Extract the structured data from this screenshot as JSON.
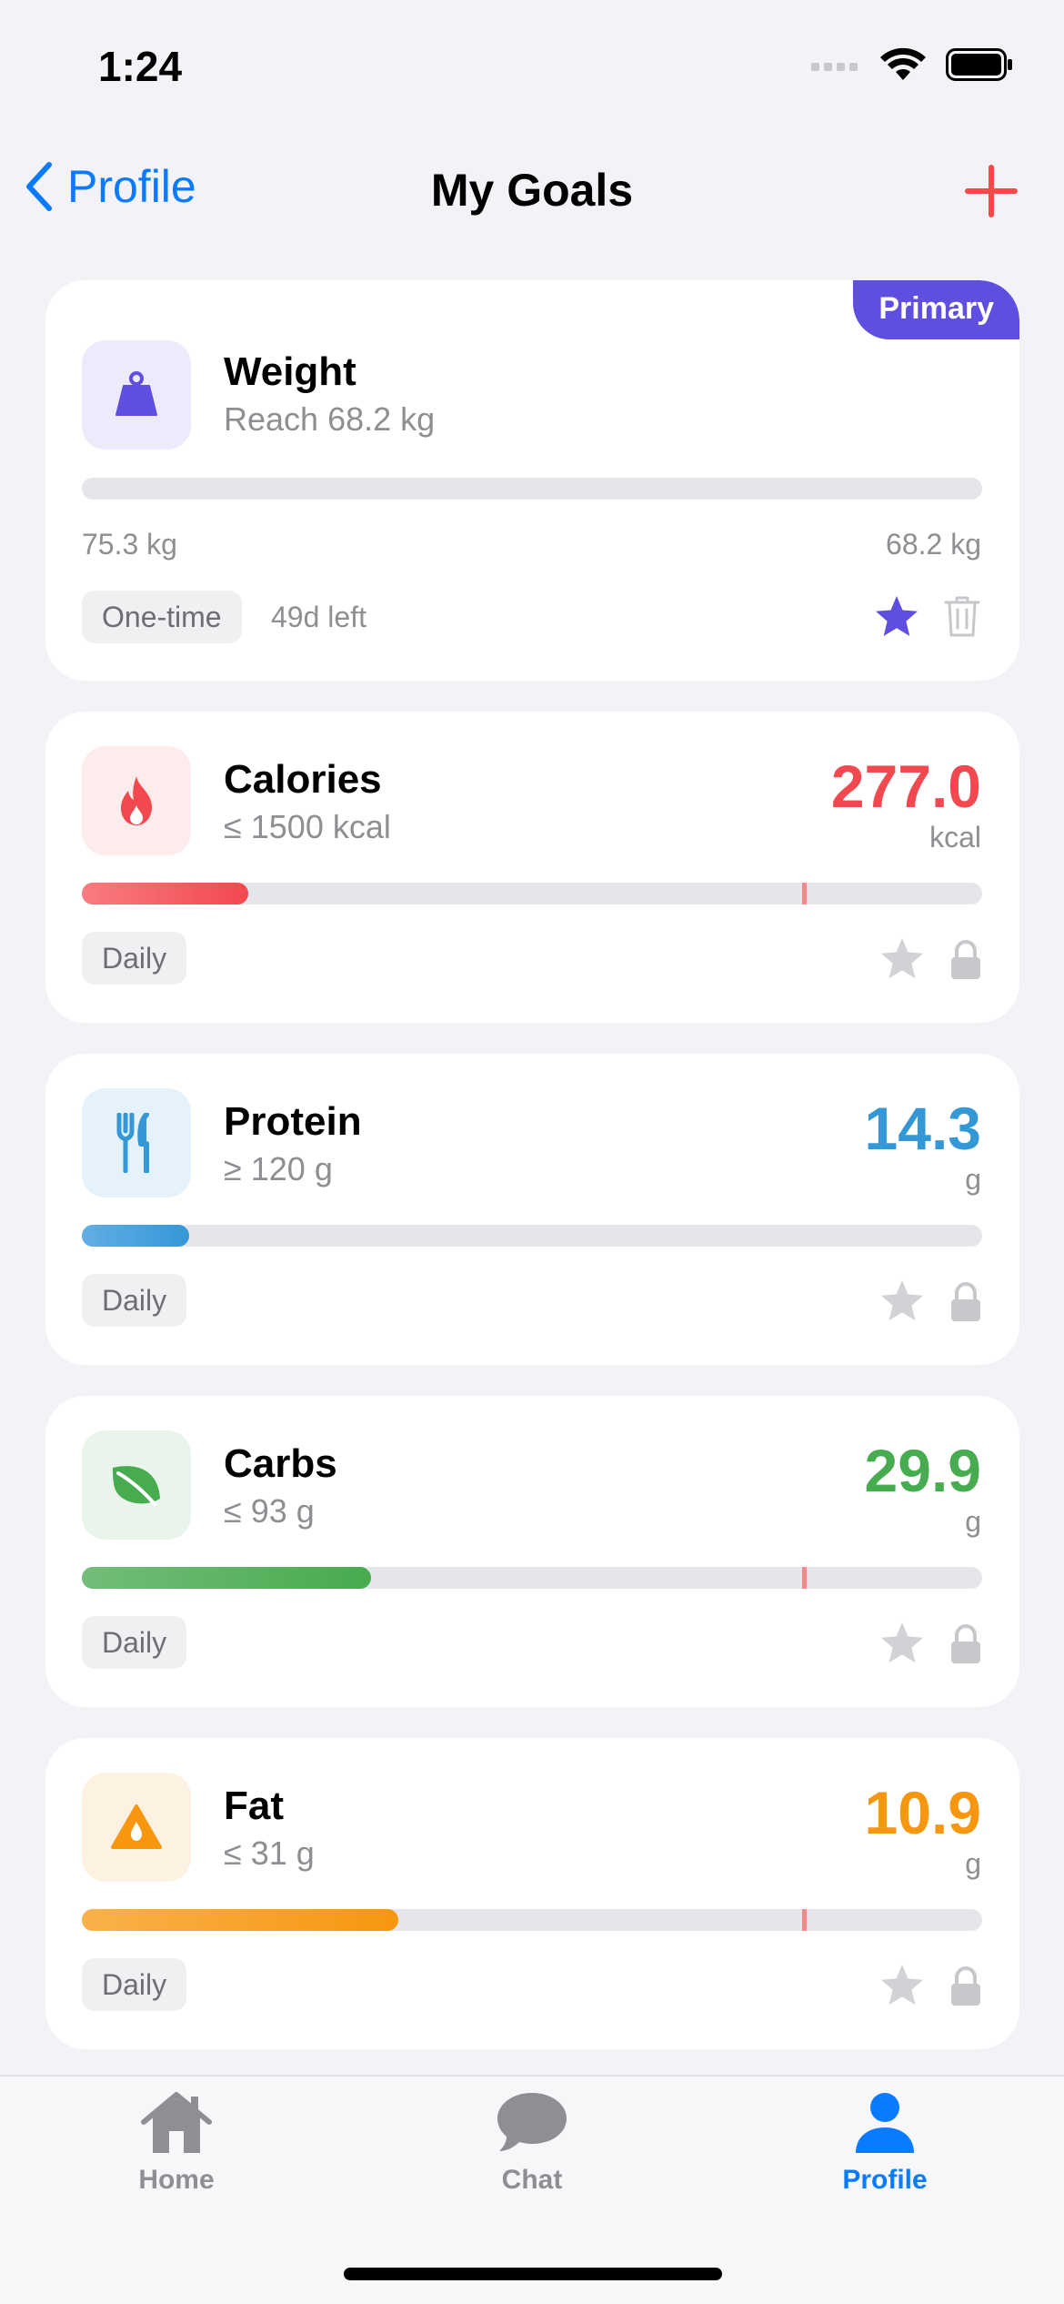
{
  "status_bar": {
    "time": "1:24"
  },
  "nav": {
    "back_label": "Profile",
    "title": "My Goals"
  },
  "colors": {
    "accent_blue": "#0A7AFF",
    "primary_purple": "#5E4FE0",
    "calories_red": "#F2484F",
    "protein_blue": "#3497D6",
    "carbs_green": "#47AB4F",
    "fat_orange": "#F7960F",
    "add_red": "#F24A4A"
  },
  "goals": [
    {
      "name": "Weight",
      "target": "Reach 68.2 kg",
      "badge": "Primary",
      "icon": "weight-icon",
      "progress": 0,
      "start_label": "75.3 kg",
      "end_label": "68.2 kg",
      "frequency": "One-time",
      "time_left": "49d left",
      "starred": true
    },
    {
      "name": "Calories",
      "target": "≤ 1500 kcal",
      "value": "277.0",
      "unit": "kcal",
      "icon": "flame-icon",
      "progress": 0.185,
      "marker": 0.8,
      "frequency": "Daily",
      "starred": false
    },
    {
      "name": "Protein",
      "target": "≥ 120 g",
      "value": "14.3",
      "unit": "g",
      "icon": "fork-knife-icon",
      "progress": 0.119,
      "frequency": "Daily",
      "starred": false
    },
    {
      "name": "Carbs",
      "target": "≤ 93 g",
      "value": "29.9",
      "unit": "g",
      "icon": "leaf-icon",
      "progress": 0.321,
      "marker": 0.8,
      "frequency": "Daily",
      "starred": false
    },
    {
      "name": "Fat",
      "target": "≤ 31 g",
      "value": "10.9",
      "unit": "g",
      "icon": "drop-triangle-icon",
      "progress": 0.352,
      "marker": 0.8,
      "frequency": "Daily",
      "starred": false
    }
  ],
  "tabbar": {
    "items": [
      {
        "label": "Home",
        "icon": "house-icon",
        "active": false
      },
      {
        "label": "Chat",
        "icon": "chat-bubble-icon",
        "active": false
      },
      {
        "label": "Profile",
        "icon": "person-icon",
        "active": true
      }
    ]
  }
}
